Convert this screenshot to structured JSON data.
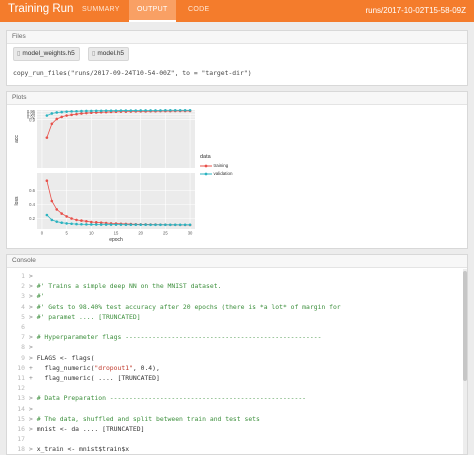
{
  "header": {
    "title": "Training Run",
    "tabs": [
      "SUMMARY",
      "OUTPUT",
      "CODE"
    ],
    "active_tab": "OUTPUT",
    "run_id": "runs/2017-10-02T15-58-09Z"
  },
  "files": {
    "heading": "Files",
    "chips": [
      "model_weights.h5",
      "model.h5"
    ],
    "copy_cmd": "copy_run_files(\"runs/2017-09-24T10-54-00Z\", to = \"target-dir\")"
  },
  "plots": {
    "heading": "Plots",
    "chart_data": [
      {
        "type": "line",
        "ylabel": "acc",
        "xlabel": "",
        "x_ticks": [
          0,
          5,
          10,
          15,
          20,
          25,
          30
        ],
        "ylim": [
          0.55,
          0.97
        ],
        "y_ticks": [
          0.9,
          0.92,
          0.94,
          0.96
        ],
        "series": [
          {
            "name": "training",
            "color": "#e8504a",
            "x": [
              1,
              2,
              3,
              4,
              5,
              6,
              7,
              8,
              9,
              10,
              11,
              12,
              13,
              14,
              15,
              16,
              17,
              18,
              19,
              20,
              21,
              22,
              23,
              24,
              25,
              26,
              27,
              28,
              29,
              30
            ],
            "y": [
              0.77,
              0.87,
              0.905,
              0.92,
              0.93,
              0.935,
              0.94,
              0.945,
              0.948,
              0.95,
              0.952,
              0.954,
              0.955,
              0.956,
              0.957,
              0.958,
              0.958,
              0.959,
              0.96,
              0.96,
              0.96,
              0.961,
              0.961,
              0.962,
              0.962,
              0.962,
              0.963,
              0.963,
              0.963,
              0.963
            ]
          },
          {
            "name": "validation",
            "color": "#2bb3c0",
            "x": [
              1,
              2,
              3,
              4,
              5,
              6,
              7,
              8,
              9,
              10,
              11,
              12,
              13,
              14,
              15,
              16,
              17,
              18,
              19,
              20,
              21,
              22,
              23,
              24,
              25,
              26,
              27,
              28,
              29,
              30
            ],
            "y": [
              0.93,
              0.945,
              0.952,
              0.955,
              0.958,
              0.96,
              0.961,
              0.962,
              0.963,
              0.963,
              0.964,
              0.964,
              0.965,
              0.965,
              0.965,
              0.966,
              0.966,
              0.966,
              0.966,
              0.967,
              0.967,
              0.967,
              0.967,
              0.967,
              0.968,
              0.968,
              0.968,
              0.968,
              0.968,
              0.968
            ]
          }
        ]
      },
      {
        "type": "line",
        "ylabel": "loss",
        "xlabel": "epoch",
        "x_ticks": [
          0,
          5,
          10,
          15,
          20,
          25,
          30
        ],
        "ylim": [
          0.05,
          0.85
        ],
        "y_ticks": [
          0.2,
          0.4,
          0.6
        ],
        "series": [
          {
            "name": "training",
            "color": "#e8504a",
            "x": [
              1,
              2,
              3,
              4,
              5,
              6,
              7,
              8,
              9,
              10,
              11,
              12,
              13,
              14,
              15,
              16,
              17,
              18,
              19,
              20,
              21,
              22,
              23,
              24,
              25,
              26,
              27,
              28,
              29,
              30
            ],
            "y": [
              0.74,
              0.45,
              0.33,
              0.27,
              0.23,
              0.2,
              0.18,
              0.17,
              0.16,
              0.15,
              0.145,
              0.14,
              0.135,
              0.13,
              0.128,
              0.125,
              0.123,
              0.12,
              0.118,
              0.116,
              0.115,
              0.114,
              0.113,
              0.112,
              0.111,
              0.11,
              0.11,
              0.109,
              0.109,
              0.108
            ]
          },
          {
            "name": "validation",
            "color": "#2bb3c0",
            "x": [
              1,
              2,
              3,
              4,
              5,
              6,
              7,
              8,
              9,
              10,
              11,
              12,
              13,
              14,
              15,
              16,
              17,
              18,
              19,
              20,
              21,
              22,
              23,
              24,
              25,
              26,
              27,
              28,
              29,
              30
            ],
            "y": [
              0.25,
              0.18,
              0.155,
              0.14,
              0.13,
              0.125,
              0.12,
              0.118,
              0.116,
              0.115,
              0.114,
              0.113,
              0.113,
              0.112,
              0.112,
              0.112,
              0.111,
              0.111,
              0.111,
              0.111,
              0.111,
              0.11,
              0.11,
              0.11,
              0.11,
              0.11,
              0.11,
              0.11,
              0.11,
              0.11
            ]
          }
        ]
      }
    ],
    "legend": {
      "title": "data",
      "items": [
        "training",
        "validation"
      ]
    }
  },
  "console": {
    "heading": "Console",
    "lines": [
      {
        "n": "1",
        "p": ">",
        "parts": [
          {
            "c": "tx",
            "t": ""
          }
        ]
      },
      {
        "n": "2",
        "p": ">",
        "parts": [
          {
            "c": "cm",
            "t": "#' Trains a simple deep NN on the MNIST dataset."
          }
        ]
      },
      {
        "n": "3",
        "p": ">",
        "parts": [
          {
            "c": "cm",
            "t": "#'"
          }
        ]
      },
      {
        "n": "4",
        "p": ">",
        "parts": [
          {
            "c": "cm",
            "t": "#' Gets to 98.40% test accuracy after 20 epochs (there is *a lot* of margin for"
          }
        ]
      },
      {
        "n": "5",
        "p": ">",
        "parts": [
          {
            "c": "cm",
            "t": "#' paramet .... [TRUNCATED]"
          }
        ]
      },
      {
        "n": "6",
        "p": "",
        "parts": [
          {
            "c": "tx",
            "t": ""
          }
        ]
      },
      {
        "n": "7",
        "p": ">",
        "parts": [
          {
            "c": "cm",
            "t": "# Hyperparameter flags ---------------------------------------------------"
          }
        ]
      },
      {
        "n": "8",
        "p": ">",
        "parts": [
          {
            "c": "tx",
            "t": ""
          }
        ]
      },
      {
        "n": "9",
        "p": ">",
        "parts": [
          {
            "c": "tx",
            "t": "FLAGS <- flags("
          }
        ]
      },
      {
        "n": "10",
        "p": "+",
        "parts": [
          {
            "c": "tx",
            "t": "  flag_numeric("
          },
          {
            "c": "st",
            "t": "\"dropout1\""
          },
          {
            "c": "tx",
            "t": ", 0.4),"
          }
        ]
      },
      {
        "n": "11",
        "p": "+",
        "parts": [
          {
            "c": "tx",
            "t": "  flag_numeric( .... [TRUNCATED]"
          }
        ]
      },
      {
        "n": "12",
        "p": "",
        "parts": [
          {
            "c": "tx",
            "t": ""
          }
        ]
      },
      {
        "n": "13",
        "p": ">",
        "parts": [
          {
            "c": "cm",
            "t": "# Data Preparation ---------------------------------------------------"
          }
        ]
      },
      {
        "n": "14",
        "p": ">",
        "parts": [
          {
            "c": "tx",
            "t": ""
          }
        ]
      },
      {
        "n": "15",
        "p": ">",
        "parts": [
          {
            "c": "cm",
            "t": "# The data, shuffled and split between train and test sets"
          }
        ]
      },
      {
        "n": "16",
        "p": ">",
        "parts": [
          {
            "c": "tx",
            "t": "mnist <- da .... [TRUNCATED]"
          }
        ]
      },
      {
        "n": "17",
        "p": "",
        "parts": [
          {
            "c": "tx",
            "t": ""
          }
        ]
      },
      {
        "n": "18",
        "p": ">",
        "parts": [
          {
            "c": "tx",
            "t": "x_train <- mnist$train$x"
          }
        ]
      }
    ]
  }
}
